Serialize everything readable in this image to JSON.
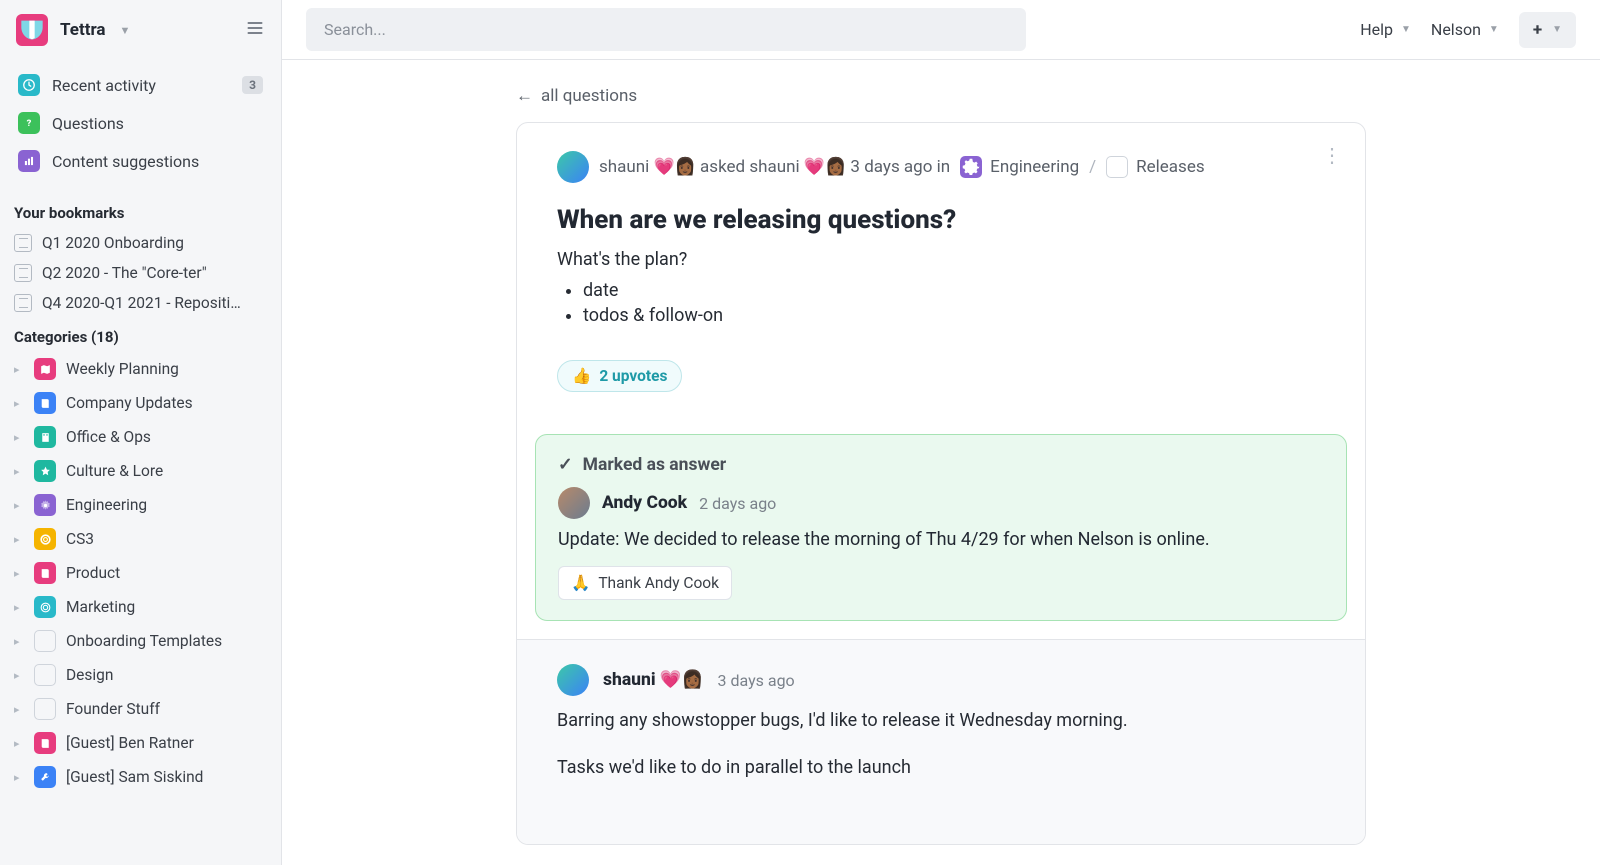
{
  "workspace": {
    "name": "Tettra"
  },
  "search": {
    "placeholder": "Search..."
  },
  "topbar": {
    "help": "Help",
    "user": "Nelson"
  },
  "nav": {
    "recent": {
      "label": "Recent activity",
      "badge": "3"
    },
    "questions": {
      "label": "Questions"
    },
    "suggestions": {
      "label": "Content suggestions"
    }
  },
  "bookmarks": {
    "title": "Your bookmarks",
    "items": [
      {
        "label": "Q1 2020 Onboarding"
      },
      {
        "label": "Q2 2020 - The \"Core-ter\""
      },
      {
        "label": "Q4 2020-Q1 2021 - Repositio…"
      }
    ]
  },
  "categories": {
    "title": "Categories (18)",
    "items": [
      {
        "label": "Weekly Planning",
        "color": "#e73c7e",
        "icon": "map"
      },
      {
        "label": "Company Updates",
        "color": "#3b82f6",
        "icon": "book"
      },
      {
        "label": "Office & Ops",
        "color": "#1fb8a0",
        "icon": "building"
      },
      {
        "label": "Culture & Lore",
        "color": "#1fb8a0",
        "icon": "star"
      },
      {
        "label": "Engineering",
        "color": "#8a63d2",
        "icon": "gear"
      },
      {
        "label": "CS3",
        "color": "#f5b400",
        "icon": "life-ring"
      },
      {
        "label": "Product",
        "color": "#e73c7e",
        "icon": "book"
      },
      {
        "label": "Marketing",
        "color": "#29b9c9",
        "icon": "target"
      },
      {
        "label": "Onboarding Templates",
        "color": "",
        "icon": "blank"
      },
      {
        "label": "Design",
        "color": "",
        "icon": "blank"
      },
      {
        "label": "Founder Stuff",
        "color": "",
        "icon": "blank"
      },
      {
        "label": "[Guest] Ben Ratner",
        "color": "#e73c7e",
        "icon": "book"
      },
      {
        "label": "[Guest] Sam Siskind",
        "color": "#3b82f6",
        "icon": "wrench"
      }
    ]
  },
  "back_link": "all questions",
  "question": {
    "author": "shauni 💗👩🏾‍",
    "prefix_asked": " asked ",
    "assignee": "shauni 💗👩🏾‍",
    "time_suffix": " 3 days ago in ",
    "category": "Engineering",
    "subcategory": "Releases",
    "title": "When are we releasing questions?",
    "body_lead": "What's the plan?",
    "body_items": [
      "date",
      "todos & follow-on"
    ],
    "upvotes": "2 upvotes",
    "upvote_emoji": "👍"
  },
  "answer": {
    "marked_label": "Marked as answer",
    "author": "Andy Cook",
    "time": "2 days ago",
    "body": "Update: We decided to release the morning of Thu 4/29  for when Nelson is online.",
    "thank": "Thank Andy Cook",
    "thank_emoji": "🙏"
  },
  "reply": {
    "author": "shauni 💗👩🏾‍",
    "time": "3 days ago",
    "p1": "Barring any showstopper bugs, I'd like to release it Wednesday morning.",
    "p2": "Tasks we'd like to do in parallel to the launch"
  }
}
